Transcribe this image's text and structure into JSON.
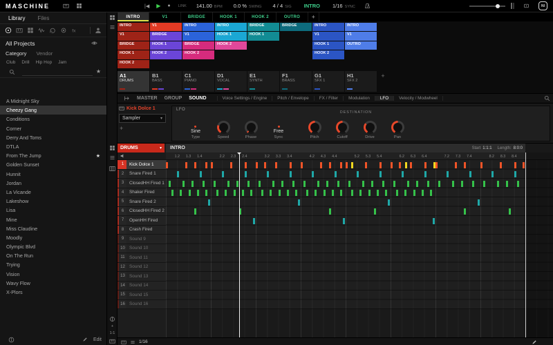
{
  "colors": {
    "accent": "#d8311f",
    "note_orange": "#f05428",
    "note_teal": "#1fa8a8",
    "note_green": "#35c24a",
    "note_yellow": "#f0d820"
  },
  "header": {
    "app_name": "MASCHINE",
    "link_label": "LINK",
    "bpm_value": "141.00",
    "bpm_label": "BPM",
    "swing_value": "0.0 %",
    "swing_label": "SWING",
    "sig_value": "4 / 4",
    "sig_label": "SIG",
    "follow_value": "INTRO",
    "step_value": "1/16",
    "sync_label": "SYNC"
  },
  "sidebar": {
    "tabs": [
      {
        "label": "Library",
        "active": true
      },
      {
        "label": "Files",
        "active": false
      }
    ],
    "browser_icons": [
      {
        "name": "projects",
        "active": true
      },
      {
        "name": "instruments",
        "active": false
      },
      {
        "name": "groups",
        "active": false
      },
      {
        "name": "sounds",
        "active": false
      },
      {
        "name": "loops",
        "active": false
      },
      {
        "name": "one-shots",
        "active": false
      },
      {
        "name": "effects",
        "active": false
      }
    ],
    "all_projects_label": "All Projects",
    "filter_sections": [
      {
        "label": "Category",
        "active": true
      },
      {
        "label": "Vendor",
        "active": false
      }
    ],
    "filter_tags": [
      "Club",
      "Drill",
      "Hip Hop",
      "Jam"
    ],
    "search_placeholder": "",
    "projects": [
      {
        "name": "A Midnight Sky",
        "selected": false,
        "starred": false
      },
      {
        "name": "Cheezy Gang",
        "selected": true,
        "starred": false
      },
      {
        "name": "Conditions",
        "selected": false,
        "starred": false
      },
      {
        "name": "Corner",
        "selected": false,
        "starred": false
      },
      {
        "name": "Derry And Toms",
        "selected": false,
        "starred": false
      },
      {
        "name": "DTLA",
        "selected": false,
        "starred": false
      },
      {
        "name": "From The Jump",
        "selected": false,
        "starred": true
      },
      {
        "name": "Golden Sunset",
        "selected": false,
        "starred": false
      },
      {
        "name": "Hunnit",
        "selected": false,
        "starred": false
      },
      {
        "name": "Jordan",
        "selected": false,
        "starred": false
      },
      {
        "name": "La Vicande",
        "selected": false,
        "starred": false
      },
      {
        "name": "Lakeshow",
        "selected": false,
        "starred": false
      },
      {
        "name": "Lisa",
        "selected": false,
        "starred": false
      },
      {
        "name": "Mine",
        "selected": false,
        "starred": false
      },
      {
        "name": "Miss Claudine",
        "selected": false,
        "starred": false
      },
      {
        "name": "Moodly",
        "selected": false,
        "starred": false
      },
      {
        "name": "Olympic Blvd",
        "selected": false,
        "starred": false
      },
      {
        "name": "On The Run",
        "selected": false,
        "starred": false
      },
      {
        "name": "Trying",
        "selected": false,
        "starred": false
      },
      {
        "name": "Vision",
        "selected": false,
        "starred": false
      },
      {
        "name": "Wavy Flow",
        "selected": false,
        "starred": false
      },
      {
        "name": "X-Plors",
        "selected": false,
        "starred": false
      }
    ],
    "edit_label": "Edit"
  },
  "arranger": {
    "section_tabs": [
      {
        "label": "INTRO",
        "active": true
      },
      {
        "label": "V1",
        "active": false
      },
      {
        "label": "BRIDGE",
        "active": false
      },
      {
        "label": "HOOK 1",
        "active": false
      },
      {
        "label": "HOOK 2",
        "active": false
      },
      {
        "label": "OUTRO",
        "active": false
      },
      {
        "label": "+",
        "active": false
      }
    ],
    "clip_colors": {
      "darkred": "#9e2317",
      "red": "#e23a24",
      "purple": "#6b45d8",
      "blue": "#2b63d9",
      "cyan": "#1ba7d4",
      "teal": "#128c94",
      "tealdark": "#0d6b7d",
      "magenta": "#d62b7d",
      "pink": "#e0489a",
      "bluemid": "#2b55c4",
      "bluelight": "#4f7de8"
    },
    "clip_rows": [
      [
        {
          "label": "INTRO",
          "color": "darkred"
        },
        {
          "label": "V1",
          "color": "red"
        },
        {
          "label": "INTRO",
          "color": "blue"
        },
        {
          "label": "INTRO",
          "color": "cyan"
        },
        {
          "label": "BRIDGE",
          "color": "teal"
        },
        {
          "label": "BRIDGE",
          "color": "tealdark"
        },
        {
          "label": "INTRO",
          "color": "bluemid"
        },
        {
          "label": "INTRO",
          "color": "bluelight"
        }
      ],
      [
        {
          "label": "V1",
          "color": "darkred"
        },
        {
          "label": "BRIDGE",
          "color": "purple"
        },
        {
          "label": "V1",
          "color": "blue"
        },
        {
          "label": "HOOK 1",
          "color": "cyan"
        },
        {
          "label": "HOOK 1",
          "color": "teal"
        },
        null,
        {
          "label": "V1",
          "color": "bluemid"
        },
        {
          "label": "V1",
          "color": "bluelight"
        }
      ],
      [
        {
          "label": "BRIDGE",
          "color": "darkred"
        },
        {
          "label": "HOOK 1",
          "color": "purple"
        },
        {
          "label": "BRIDGE",
          "color": "magenta"
        },
        {
          "label": "HOOK 2",
          "color": "pink"
        },
        null,
        null,
        {
          "label": "HOOK 1",
          "color": "bluemid"
        },
        {
          "label": "OUTRO",
          "color": "bluelight"
        }
      ],
      [
        {
          "label": "HOOK 1",
          "color": "darkred"
        },
        {
          "label": "HOOK 2",
          "color": "purple"
        },
        {
          "label": "HOOK 2",
          "color": "magenta"
        },
        null,
        null,
        null,
        {
          "label": "HOOK 2",
          "color": "bluemid"
        },
        null
      ],
      [
        {
          "label": "HOOK 2",
          "color": "darkred"
        },
        null,
        null,
        null,
        null,
        null,
        null,
        null
      ]
    ],
    "groups": [
      {
        "slot": "A1",
        "name": "DRUMS",
        "selected": true
      },
      {
        "slot": "B1",
        "name": "BASS",
        "selected": false
      },
      {
        "slot": "C1",
        "name": "PIANO",
        "selected": false
      },
      {
        "slot": "D1",
        "name": "VOCAL",
        "selected": false
      },
      {
        "slot": "E1",
        "name": "SYNTH",
        "selected": false
      },
      {
        "slot": "F1",
        "name": "BRASS",
        "selected": false
      },
      {
        "slot": "G1",
        "name": "SFX 1",
        "selected": false
      },
      {
        "slot": "H1",
        "name": "SFX 2",
        "selected": false
      }
    ],
    "add_group_label": "+"
  },
  "plugin": {
    "scope_tabs": [
      {
        "label": "MASTER",
        "active": false
      },
      {
        "label": "GROUP",
        "active": false
      },
      {
        "label": "SOUND",
        "active": true
      }
    ],
    "chain_tabs": [
      {
        "label": "Voice Settings / Engine",
        "active": false
      },
      {
        "label": "Pitch / Envelope",
        "active": false
      },
      {
        "label": "FX / Filter",
        "active": false
      },
      {
        "label": "Modulation",
        "active": false
      },
      {
        "label": "LFO",
        "active": true
      },
      {
        "label": "Velocity / Modwheel",
        "active": false
      }
    ],
    "sound_name": "Kick Dolce 1",
    "device_name": "Sampler",
    "add_label": "+",
    "panel_label": "LFO",
    "destination_label": "DESTINATION",
    "params": [
      {
        "kind": "enum",
        "value": "Sine",
        "label": "Type",
        "dest": false
      },
      {
        "kind": "knob",
        "label": "Speed",
        "arc": 80,
        "dest": false
      },
      {
        "kind": "knob",
        "label": "Phase",
        "arc": 15,
        "dest": false
      },
      {
        "kind": "enum",
        "value": "Free",
        "label": "Sync",
        "dest": false
      },
      {
        "kind": "knob",
        "label": "Pitch",
        "arc": 150,
        "dest": true
      },
      {
        "kind": "knob",
        "label": "Cutoff",
        "arc": 150,
        "dest": true
      },
      {
        "kind": "knob",
        "label": "Drive",
        "arc": 100,
        "dest": true
      },
      {
        "kind": "knob",
        "label": "Pan",
        "arc": 150,
        "dest": true
      }
    ]
  },
  "editor": {
    "group_name": "DRUMS",
    "pattern_name": "INTRO",
    "start_label": "Start",
    "start_value": "1:1:1",
    "length_label": "Length:",
    "length_value": "8:0:0",
    "bars": 8,
    "beats_per_bar": 4,
    "playhead_beat": 6.5,
    "grid_value": "1/16",
    "zoom_value": "1:1",
    "ruler_labels": [
      "1.2",
      "1.3",
      "1.4",
      "2.2",
      "2.3",
      "2.4",
      "3.2",
      "3.3",
      "3.4",
      "4.2",
      "4.3",
      "4.4",
      "5.2",
      "5.3",
      "5.4",
      "6.2",
      "6.3",
      "6.4",
      "7.2",
      "7.3",
      "7.4",
      "8.2",
      "8.3",
      "8.4"
    ],
    "sounds": [
      {
        "num": "1",
        "name": "Kick Dolce 1",
        "selected": true,
        "empty": false
      },
      {
        "num": "2",
        "name": "Snare Fired 1",
        "selected": false,
        "empty": false
      },
      {
        "num": "3",
        "name": "ClosedHH Fired 1",
        "selected": false,
        "empty": false
      },
      {
        "num": "4",
        "name": "Shaker Fired",
        "selected": false,
        "empty": false
      },
      {
        "num": "5",
        "name": "Snare Fired 2",
        "selected": false,
        "empty": false
      },
      {
        "num": "6",
        "name": "ClosedHH Fired 2",
        "selected": false,
        "empty": false
      },
      {
        "num": "7",
        "name": "OpenHH Fired",
        "selected": false,
        "empty": false
      },
      {
        "num": "8",
        "name": "Crash Fired",
        "selected": false,
        "empty": false
      },
      {
        "num": "9",
        "name": "Sound 9",
        "selected": false,
        "empty": true
      },
      {
        "num": "10",
        "name": "Sound 10",
        "selected": false,
        "empty": true
      },
      {
        "num": "11",
        "name": "Sound 11",
        "selected": false,
        "empty": true
      },
      {
        "num": "12",
        "name": "Sound 12",
        "selected": false,
        "empty": true
      },
      {
        "num": "13",
        "name": "Sound 13",
        "selected": false,
        "empty": true
      },
      {
        "num": "14",
        "name": "Sound 14",
        "selected": false,
        "empty": true
      },
      {
        "num": "15",
        "name": "Sound 15",
        "selected": false,
        "empty": true
      },
      {
        "num": "16",
        "name": "Sound 16",
        "selected": false,
        "empty": true
      }
    ],
    "notes": [
      {
        "row": 1,
        "color": "note_orange",
        "beats": [
          0,
          1.75,
          2.5,
          3.5,
          4,
          5.75,
          7,
          8,
          8.75,
          9.75,
          11,
          12,
          13.75,
          14.5,
          15.5,
          16,
          17.75,
          19,
          20,
          20.75,
          21.75,
          23,
          24,
          25.75,
          26.5,
          28,
          29.75,
          31,
          31.75
        ]
      },
      {
        "row": 1,
        "color": "note_yellow",
        "beats": [
          16.5,
          21.3,
          23.8
        ]
      },
      {
        "row": 2,
        "color": "note_teal",
        "beats": [
          1,
          3,
          5,
          7,
          9,
          11,
          13,
          15,
          17,
          19,
          21,
          23,
          25,
          27,
          29,
          31
        ]
      },
      {
        "row": 3,
        "color": "note_green",
        "beats": [
          0.25,
          1.5,
          2.25,
          3.25,
          4.25,
          5.5,
          6.25,
          7.25,
          8.25,
          9.5,
          10.25,
          11.25,
          12.25,
          13.5,
          14.25,
          15.25,
          16.25,
          17.5,
          18.25,
          19.25,
          20.25,
          21.5,
          22.25,
          23.25,
          24.25,
          25.5,
          26.25,
          27.25,
          28.25,
          29.5,
          30.25,
          31.25
        ]
      },
      {
        "row": 4,
        "color": "note_green",
        "beats": [
          0.5,
          1.25,
          2,
          2.75,
          3.5,
          4.5,
          5.25,
          6,
          6.75,
          7.5,
          8.5,
          9.25,
          10,
          10.75,
          11.5,
          12.5,
          13.25,
          14,
          14.75,
          15.5,
          16.5,
          17.25,
          18,
          18.75,
          19.5,
          20.5,
          21.25,
          22,
          22.75,
          23.5
        ]
      },
      {
        "row": 5,
        "color": "note_teal",
        "beats": [
          3.75,
          11.75,
          19.75,
          27.75
        ]
      },
      {
        "row": 6,
        "color": "note_green",
        "beats": [
          2.5,
          6.5,
          14.5,
          18.5,
          26.5,
          30.5
        ]
      },
      {
        "row": 7,
        "color": "note_teal",
        "beats": [
          7.75,
          15.75,
          23.75
        ]
      }
    ]
  }
}
